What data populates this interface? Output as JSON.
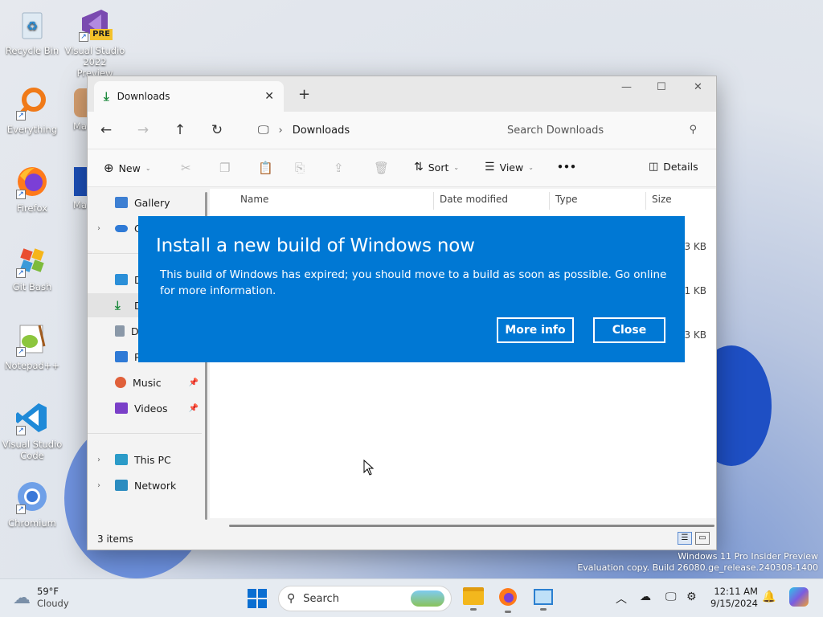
{
  "desktop": {
    "icons": [
      {
        "label": "Recycle Bin",
        "icon": "recycle-bin-icon"
      },
      {
        "label": "Visual Studio 2022 Preview",
        "icon": "visual-studio-icon",
        "badge": "PRE"
      },
      {
        "label": "Everything",
        "icon": "everything-search-icon"
      },
      {
        "label": "Ma",
        "icon": "app-shortcut-icon"
      },
      {
        "label": "Firefox",
        "icon": "firefox-icon"
      },
      {
        "label": "Ma",
        "icon": "app-shortcut-icon"
      },
      {
        "label": "Git Bash",
        "icon": "git-bash-icon"
      },
      {
        "label": "Notepad++",
        "icon": "notepad-plus-icon"
      },
      {
        "label": "Visual Studio Code",
        "icon": "vscode-icon"
      },
      {
        "label": "Chromium",
        "icon": "chromium-icon"
      }
    ],
    "watermark": {
      "line1": "Windows 11 Pro Insider Preview",
      "line2": "Evaluation copy. Build 26080.ge_release.240308-1400"
    }
  },
  "explorer": {
    "tab_title": "Downloads",
    "address": {
      "location": "Downloads"
    },
    "search": {
      "placeholder": "Search Downloads"
    },
    "toolbar": {
      "new_label": "New",
      "sort_label": "Sort",
      "view_label": "View",
      "more_label": "•••",
      "details_label": "Details"
    },
    "sidebar": {
      "items": [
        {
          "label": "Gallery",
          "icon": "gallery-icon"
        },
        {
          "label": "O",
          "icon": "onedrive-icon"
        },
        {
          "label": "D",
          "icon": "desktop-folder-icon"
        },
        {
          "label": "D",
          "icon": "downloads-icon"
        },
        {
          "label": "D",
          "icon": "documents-icon"
        },
        {
          "label": "Pi",
          "icon": "pictures-icon"
        },
        {
          "label": "Music",
          "icon": "music-icon"
        },
        {
          "label": "Videos",
          "icon": "videos-icon"
        },
        {
          "label": "This PC",
          "icon": "this-pc-icon"
        },
        {
          "label": "Network",
          "icon": "network-icon"
        }
      ]
    },
    "columns": [
      "Name",
      "Date modified",
      "Type",
      "Size"
    ],
    "sizes": [
      "3 KB",
      "1 KB",
      "3 KB"
    ],
    "status": "3 items"
  },
  "dialog": {
    "title": "Install a new build of Windows now",
    "message": "This build of Windows has expired; you should move to a build as soon as possible. Go online for more information.",
    "more_info_label": "More info",
    "close_label": "Close",
    "color": "#0078d4"
  },
  "taskbar": {
    "weather": {
      "temp": "59°F",
      "condition": "Cloudy"
    },
    "search_label": "Search",
    "time": "12:11 AM",
    "date": "9/15/2024"
  }
}
